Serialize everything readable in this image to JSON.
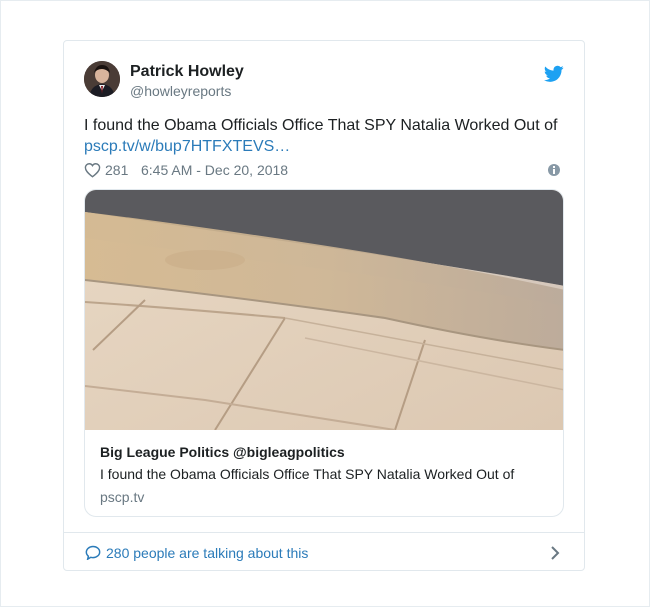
{
  "author": {
    "name": "Patrick Howley",
    "handle": "@howleyreports"
  },
  "tweet": {
    "text": "I found the Obama Officials Office That SPY Natalia Worked Out of",
    "link": "pscp.tv/w/bup7HTFXTEVS…"
  },
  "meta": {
    "likes": "281",
    "timestamp": "6:45 AM - Dec 20, 2018"
  },
  "media": {
    "title": "Big League Politics @bigleagpolitics",
    "description": "I found the Obama Officials Office That SPY Natalia Worked Out of",
    "domain": "pscp.tv"
  },
  "footer": {
    "talking": "280 people are talking about this"
  },
  "icons": {
    "bird": "twitter-bird-icon",
    "heart": "heart-icon",
    "info": "info-icon",
    "bubble": "speech-bubble-icon",
    "chevron": "chevron-right-icon"
  },
  "colors": {
    "link": "#2b7bb9",
    "brand": "#1da1f2",
    "muted": "#697882"
  }
}
